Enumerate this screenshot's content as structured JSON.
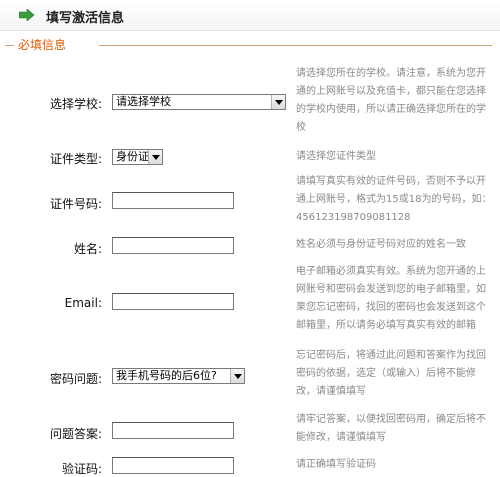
{
  "header": {
    "title": "填写激活信息",
    "icon": "arrow-right-icon",
    "accent": "#3c9b3c"
  },
  "section": {
    "legend": "必填信息",
    "legend_color": "#e05a00"
  },
  "fields": {
    "school": {
      "label": "选择学校:",
      "selected": "请选择学校",
      "help": "请选择您所在的学校。请注意，系统为您开通的上网账号以及充值卡，都只能在您选择的学校内使用，所以请正确选择您所在的学校"
    },
    "id_type": {
      "label": "证件类型:",
      "selected": "身份证",
      "help": "请选择您证件类型"
    },
    "id_number": {
      "label": "证件号码:",
      "value": "",
      "help": "请填写真实有效的证件号码，否则不予以开通上网账号，格式为15或18为的号码，如：456123198709081128"
    },
    "name": {
      "label": "姓名:",
      "value": "",
      "help": "姓名必须与身份证号码对应的姓名一致"
    },
    "email": {
      "label": "Email:",
      "value": "",
      "help": "电子邮箱必须真实有效。系统为您开通的上网账号和密码会发送到您的电子邮箱里，如果您忘记密码，找回的密码也会发送到这个邮箱里，所以请务必填写真实有效的邮箱"
    },
    "security_question": {
      "label": "密码问题:",
      "selected": "我手机号码的后6位?",
      "help": "忘记密码后，将通过此问题和答案作为找回密码的依据，选定（或输入）后将不能修改，请谨慎填写"
    },
    "security_answer": {
      "label": "问题答案:",
      "value": "",
      "help": "请牢记答案，以便找回密码用，确定后将不能修改，请谨慎填写"
    },
    "captcha": {
      "label": "验证码:",
      "value": "",
      "help": "请正确填写验证码"
    }
  }
}
